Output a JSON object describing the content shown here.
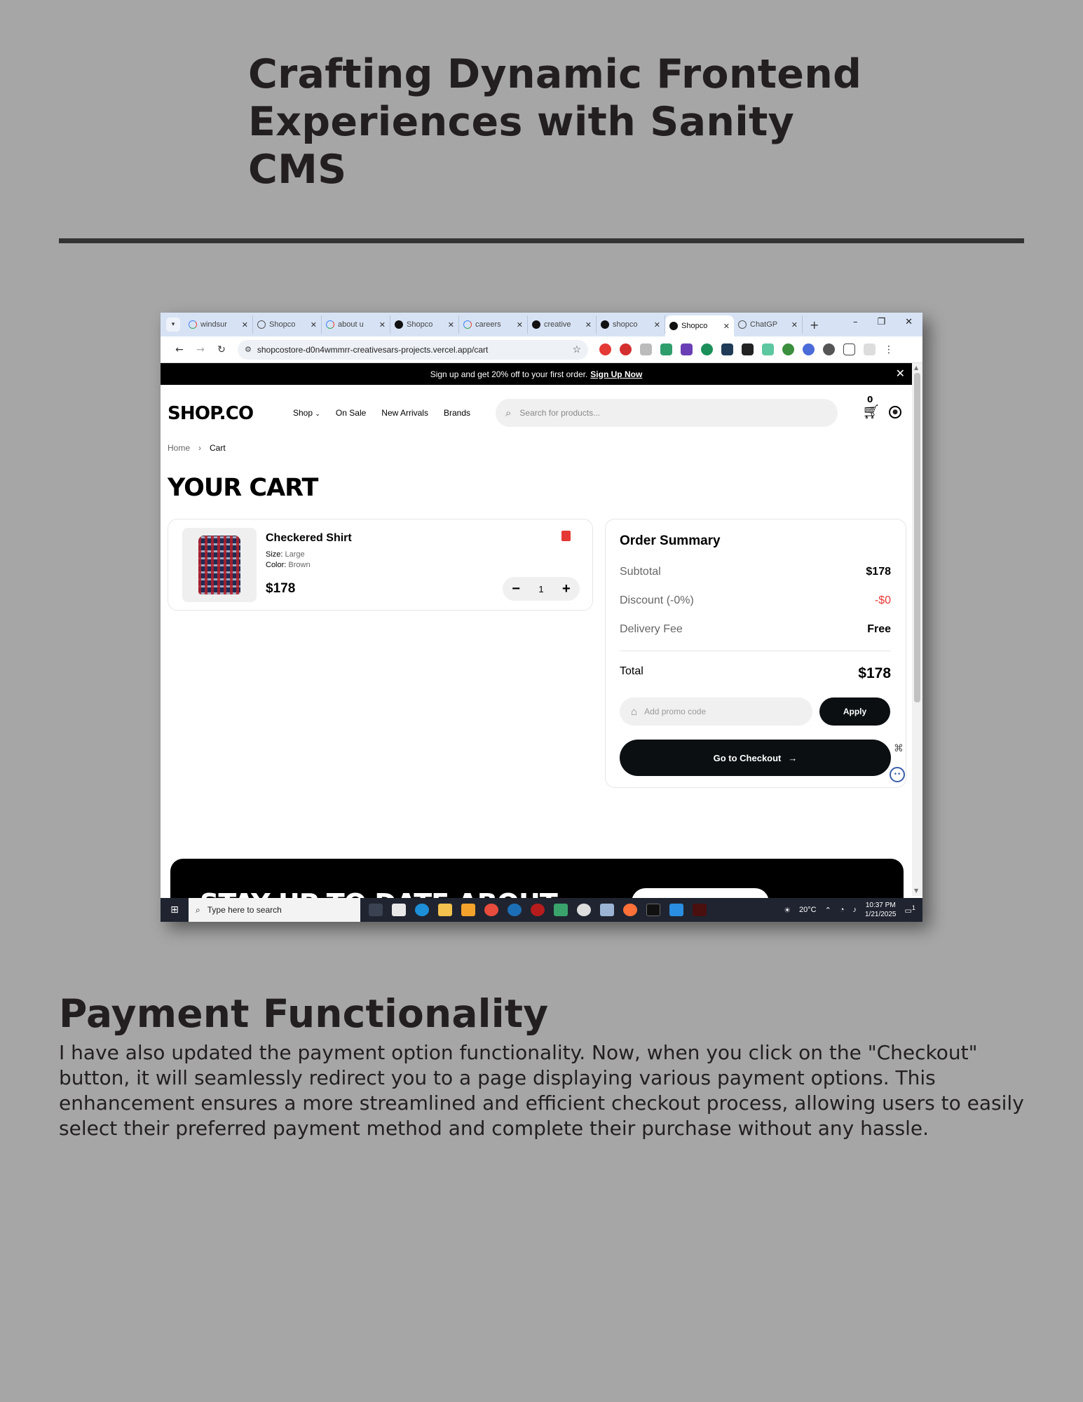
{
  "document": {
    "title_line1": "Crafting Dynamic Frontend",
    "title_line2": "Experiences with Sanity CMS",
    "section_heading": "Payment Functionality",
    "section_body": "I have also updated the payment option functionality. Now, when you click on the \"Checkout\" button, it will seamlessly redirect you to a page displaying various payment options. This enhancement ensures a more streamlined and efficient checkout process, allowing users to easily select their preferred payment method and complete their purchase without any hassle."
  },
  "browser": {
    "tabs": [
      {
        "label": "windsur",
        "favicon": "google-icon"
      },
      {
        "label": "Shopco",
        "favicon": "globe-icon"
      },
      {
        "label": "about u",
        "favicon": "google-icon"
      },
      {
        "label": "Shopco",
        "favicon": "vercel-icon"
      },
      {
        "label": "careers",
        "favicon": "google-icon"
      },
      {
        "label": "creative",
        "favicon": "github-icon"
      },
      {
        "label": "shopco",
        "favicon": "vercel-icon"
      },
      {
        "label": "Shopco",
        "favicon": "vercel-icon",
        "active": true
      },
      {
        "label": "ChatGP",
        "favicon": "openai-icon"
      }
    ],
    "url": "shopcostore-d0n4wmmrr-creativesars-projects.vercel.app/cart"
  },
  "promo_bar": {
    "text": "Sign up and get 20% off to your first order.",
    "link": "Sign Up Now"
  },
  "header": {
    "logo": "SHOP.CO",
    "nav": [
      "Shop",
      "On Sale",
      "New Arrivals",
      "Brands"
    ],
    "search_placeholder": "Search for products...",
    "cart_count": "0"
  },
  "breadcrumb": {
    "home": "Home",
    "separator": "›",
    "current": "Cart"
  },
  "cart": {
    "title": "YOUR CART",
    "item": {
      "name": "Checkered Shirt",
      "size_label": "Size:",
      "size": "Large",
      "color_label": "Color:",
      "color": "Brown",
      "price": "$178",
      "quantity": "1"
    }
  },
  "summary": {
    "title": "Order Summary",
    "subtotal_label": "Subtotal",
    "subtotal": "$178",
    "discount_label": "Discount (-0%)",
    "discount": "-$0",
    "delivery_label": "Delivery Fee",
    "delivery": "Free",
    "total_label": "Total",
    "total": "$178",
    "promo_placeholder": "Add promo code",
    "apply_label": "Apply",
    "checkout_label": "Go to Checkout"
  },
  "newsletter": {
    "text": "STAY UP TO DATE ABOUT"
  },
  "taskbar": {
    "search_text": "Type here to search",
    "weather": "20°C",
    "time": "10:37 PM",
    "date": "1/21/2025",
    "notification_count": "1"
  },
  "colors": {
    "page_background": "#a6a6a6",
    "accent_red": "#e53935",
    "button_black": "#0b0f12"
  }
}
